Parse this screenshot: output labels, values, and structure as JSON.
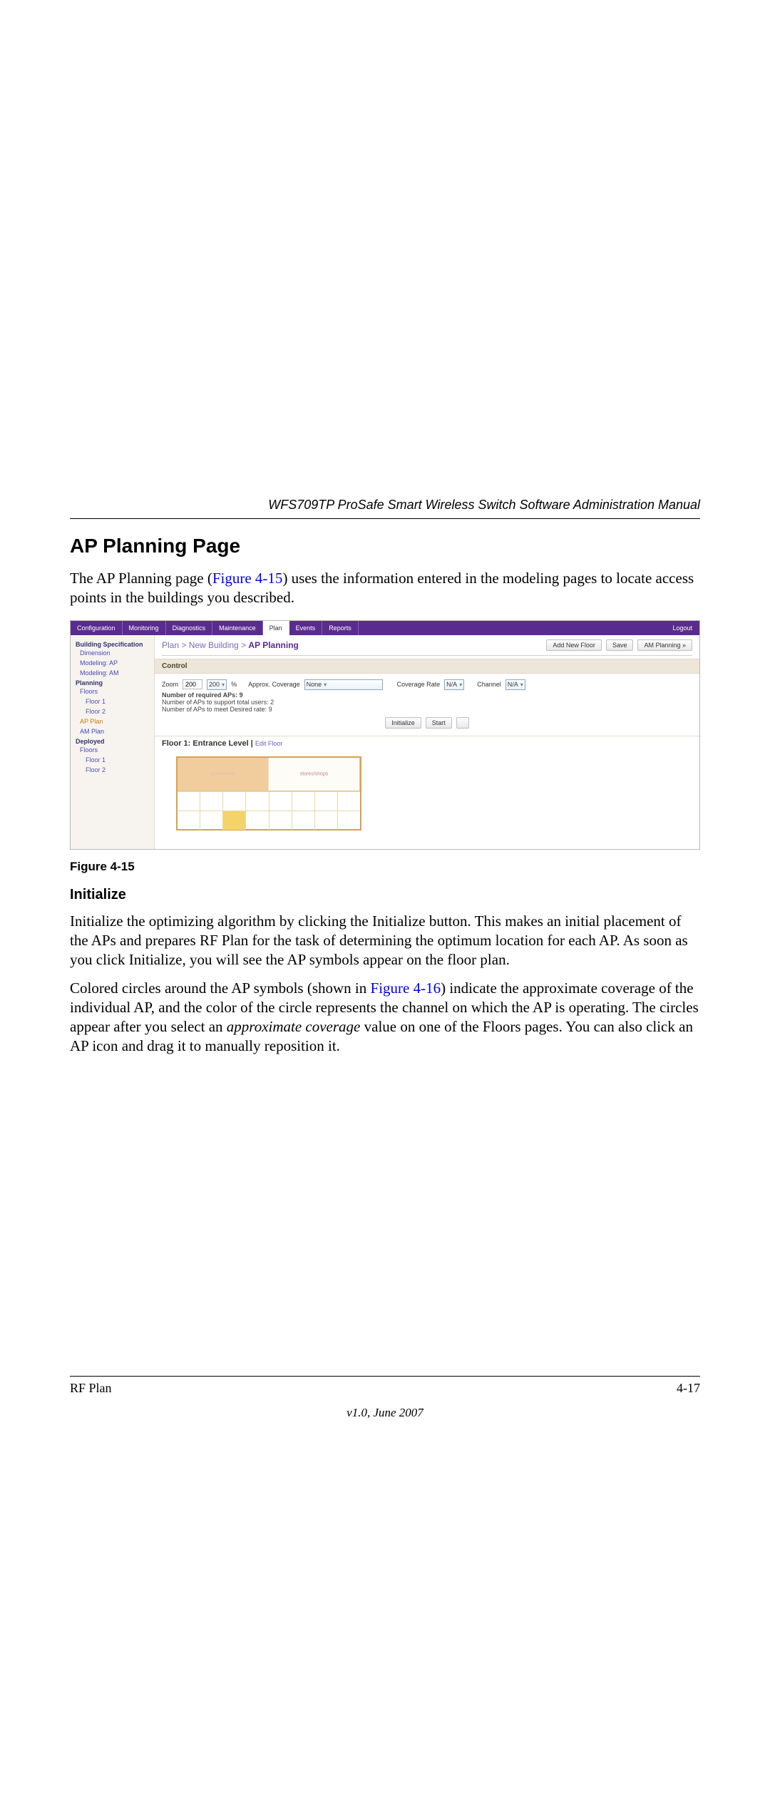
{
  "doc": {
    "running_head": "WFS709TP ProSafe Smart Wireless Switch Software Administration Manual",
    "h2": "AP Planning Page",
    "p1_a": "The AP Planning page (",
    "p1_link": "Figure 4-15",
    "p1_b": ") uses the information entered in the modeling pages to locate access points in the buildings you described.",
    "figcap": "Figure 4-15",
    "h3": "Initialize",
    "p2": "Initialize the optimizing algorithm by clicking the Initialize button. This makes an initial placement of the APs and prepares RF Plan for the task of determining the optimum location for each AP. As soon as you click Initialize, you will see the AP symbols appear on the floor plan.",
    "p3_a": "Colored circles around the AP symbols (shown in ",
    "p3_link": "Figure 4-16",
    "p3_b": ") indicate the approximate coverage of the individual AP, and the color of the circle represents the channel on which the AP is operating. The circles appear after you select an ",
    "p3_i": "approximate coverage",
    "p3_c": " value on one of the Floors pages. You can also click an AP icon and drag it to manually reposition it."
  },
  "foot": {
    "left": "RF Plan",
    "right": "4-17",
    "ver": "v1.0, June 2007"
  },
  "ss": {
    "tabs": [
      "Configuration",
      "Monitoring",
      "Diagnostics",
      "Maintenance",
      "Plan",
      "Events",
      "Reports"
    ],
    "tab_selected_index": 4,
    "logout": "Logout",
    "side": {
      "g1": "Building Specification",
      "g1_items": [
        "Dimension",
        "Modeling: AP",
        "Modeling: AM"
      ],
      "g2": "Planning",
      "g2_items": [
        "Floors",
        "Floor 1",
        "Floor 2",
        "AP Plan",
        "AM Plan"
      ],
      "g2_current": "AP Plan",
      "g3": "Deployed",
      "g3_items": [
        "Floors",
        "Floor 1",
        "Floor 2"
      ]
    },
    "crumb_a": "Plan > New Building > ",
    "crumb_b": "AP Planning",
    "btns": [
      "Add New Floor",
      "Save",
      "AM Planning  »"
    ],
    "section": "Control",
    "ctrl": {
      "zoom_label": "Zoom",
      "zoom_val": "200",
      "zoom_sel": "200",
      "pct": "%",
      "approx_label": "Approx. Coverage",
      "approx_sel": "None",
      "cov_label": "Coverage Rate",
      "cov_sel": "N/A",
      "chan_label": "Channel",
      "chan_sel": "N/A"
    },
    "req": {
      "title": "Number of required APs: 9",
      "l1": "Number of APs to support total users: 2",
      "l2": "Number of APs to meet Desired rate: 9"
    },
    "actions": [
      "Initialize",
      "Start",
      ""
    ],
    "floor_hdr": "Floor 1: Entrance Level",
    "floor_edit": "Edit Floor",
    "fp_labels": {
      "a": "apartments",
      "b": "stores/shops"
    }
  }
}
